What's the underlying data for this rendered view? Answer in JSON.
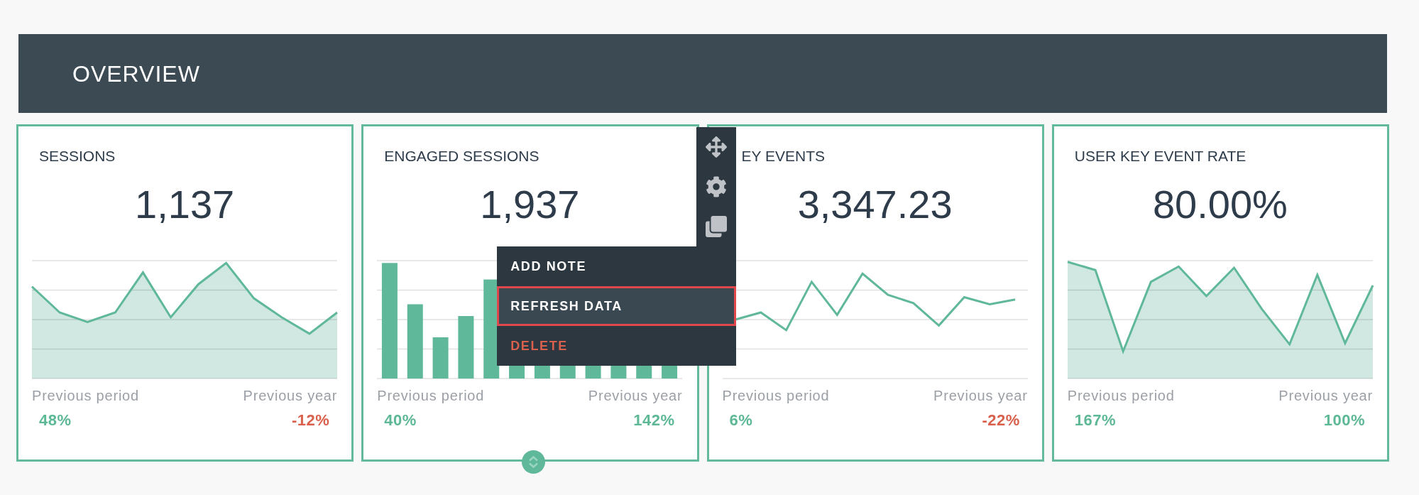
{
  "header": {
    "title": "OVERVIEW"
  },
  "cards": [
    {
      "title": "SESSIONS",
      "value": "1,137",
      "kind": "area",
      "hovered": false,
      "comparisons": [
        {
          "label": "Previous period",
          "value": "48%",
          "color": "#5cb895"
        },
        {
          "label": "Previous year",
          "value": "-12%",
          "color": "#d9604c"
        }
      ]
    },
    {
      "title": "ENGAGED SESSIONS",
      "value": "1,937",
      "kind": "bar",
      "hovered": true,
      "comparisons": [
        {
          "label": "Previous period",
          "value": "40%",
          "color": "#5cb895"
        },
        {
          "label": "Previous year",
          "value": "142%",
          "color": "#5cb895"
        }
      ]
    },
    {
      "title": "EY EVENTS",
      "value": "3,347.23",
      "kind": "line",
      "hovered": false,
      "comparisons": [
        {
          "label": "Previous period",
          "value": "6%",
          "color": "#5cb895"
        },
        {
          "label": "Previous year",
          "value": "-22%",
          "color": "#d9604c"
        }
      ]
    },
    {
      "title": "USER KEY EVENT RATE",
      "value": "80.00%",
      "kind": "area",
      "hovered": false,
      "comparisons": [
        {
          "label": "Previous period",
          "value": "167%",
          "color": "#5cb895"
        },
        {
          "label": "Previous year",
          "value": "100%",
          "color": "#5cb895"
        }
      ]
    }
  ],
  "card_menu": {
    "items": [
      {
        "label": "ADD NOTE",
        "selected": false,
        "kind": "default"
      },
      {
        "label": "REFRESH DATA",
        "selected": true,
        "kind": "default"
      },
      {
        "label": "DELETE",
        "selected": false,
        "kind": "danger"
      }
    ]
  }
}
